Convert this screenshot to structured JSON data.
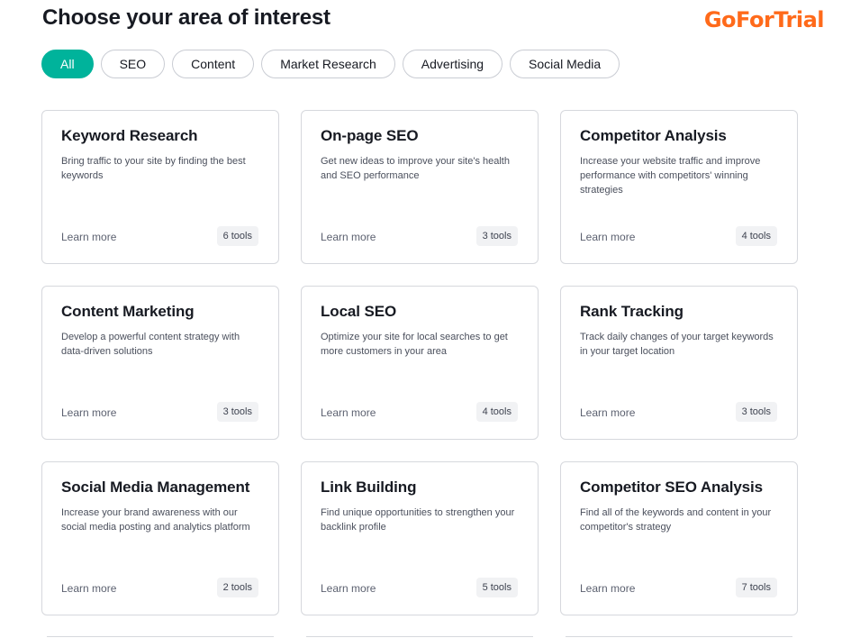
{
  "header": {
    "title": "Choose your area of interest",
    "watermark": "GoForTrial"
  },
  "filters": [
    {
      "label": "All",
      "active": true
    },
    {
      "label": "SEO",
      "active": false
    },
    {
      "label": "Content",
      "active": false
    },
    {
      "label": "Market Research",
      "active": false
    },
    {
      "label": "Advertising",
      "active": false
    },
    {
      "label": "Social Media",
      "active": false
    }
  ],
  "cards": [
    {
      "title": "Keyword Research",
      "description": "Bring traffic to your site by finding the best keywords",
      "link": "Learn more",
      "tools": "6 tools"
    },
    {
      "title": "On-page SEO",
      "description": "Get new ideas to improve your site's health and SEO performance",
      "link": "Learn more",
      "tools": "3 tools"
    },
    {
      "title": "Competitor Analysis",
      "description": "Increase your website traffic and improve performance with competitors' winning strategies",
      "link": "Learn more",
      "tools": "4 tools"
    },
    {
      "title": "Content Marketing",
      "description": "Develop a powerful content strategy with data-driven solutions",
      "link": "Learn more",
      "tools": "3 tools"
    },
    {
      "title": "Local SEO",
      "description": "Optimize your site for local searches to get more customers in your area",
      "link": "Learn more",
      "tools": "4 tools"
    },
    {
      "title": "Rank Tracking",
      "description": "Track daily changes of your target keywords in your target location",
      "link": "Learn more",
      "tools": "3 tools"
    },
    {
      "title": "Social Media Management",
      "description": "Increase your brand awareness with our social media posting and analytics platform",
      "link": "Learn more",
      "tools": "2 tools"
    },
    {
      "title": "Link Building",
      "description": "Find unique opportunities to strengthen your backlink profile",
      "link": "Learn more",
      "tools": "5 tools"
    },
    {
      "title": "Competitor SEO Analysis",
      "description": "Find all of the keywords and content in your competitor's strategy",
      "link": "Learn more",
      "tools": "7 tools"
    }
  ],
  "colors": {
    "accent": "#00b39b",
    "watermark": "#ff6a1a",
    "border": "#d6d8dd"
  }
}
